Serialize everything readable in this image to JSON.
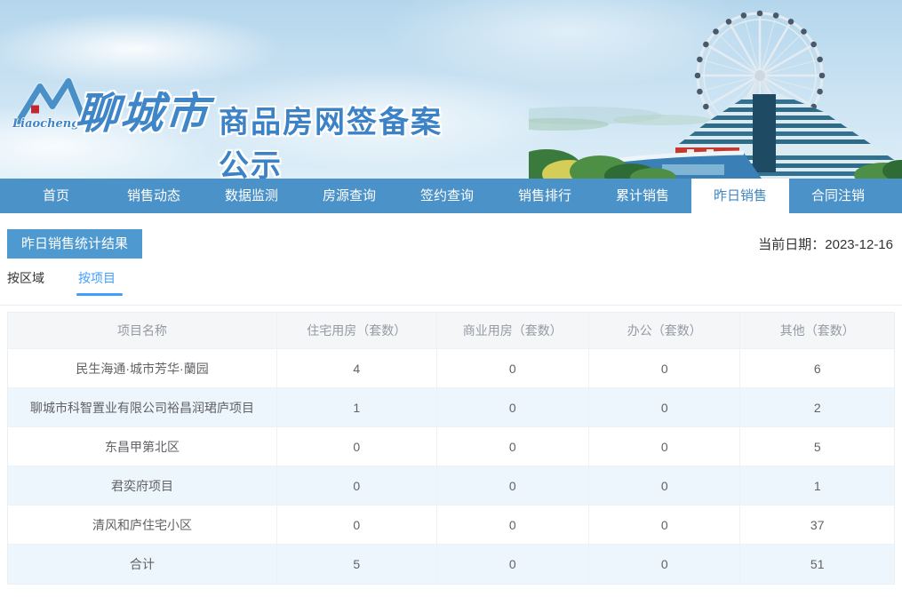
{
  "brand": {
    "logo_script": "Liaocheng",
    "city_name": "聊城市",
    "site_title": "商品房网签备案公示"
  },
  "nav": {
    "items": [
      {
        "label": "首页"
      },
      {
        "label": "销售动态"
      },
      {
        "label": "数据监测"
      },
      {
        "label": "房源查询"
      },
      {
        "label": "签约查询"
      },
      {
        "label": "销售排行"
      },
      {
        "label": "累计销售"
      },
      {
        "label": "昨日销售",
        "active": true
      },
      {
        "label": "合同注销"
      }
    ]
  },
  "page": {
    "section_title": "昨日销售统计结果",
    "current_date": "当前日期：2023-12-16"
  },
  "subtabs": [
    {
      "label": "按区域"
    },
    {
      "label": "按项目",
      "active": true
    }
  ],
  "table": {
    "headers": [
      "项目名称",
      "住宅用房（套数）",
      "商业用房（套数）",
      "办公（套数）",
      "其他（套数）"
    ],
    "rows": [
      [
        "民生海通·城市芳华·蘭园",
        "4",
        "0",
        "0",
        "6"
      ],
      [
        "聊城市科智置业有限公司裕昌润珺庐项目",
        "1",
        "0",
        "0",
        "2"
      ],
      [
        "东昌甲第北区",
        "0",
        "0",
        "0",
        "5"
      ],
      [
        "君奕府项目",
        "0",
        "0",
        "0",
        "1"
      ],
      [
        "清风和庐住宅小区",
        "0",
        "0",
        "0",
        "37"
      ],
      [
        "合计",
        "5",
        "0",
        "0",
        "51"
      ]
    ]
  },
  "colors": {
    "nav_blue": "#4b92c8",
    "badge_blue": "#4e9ad0",
    "active_tab_text": "#3e86c4",
    "subtab_active": "#409eff",
    "row_alt_bg": "#eef6fd",
    "header_bg": "#f5f6f8",
    "header_text": "#959aa3",
    "body_text": "#606266",
    "border": "#edf2f7"
  }
}
